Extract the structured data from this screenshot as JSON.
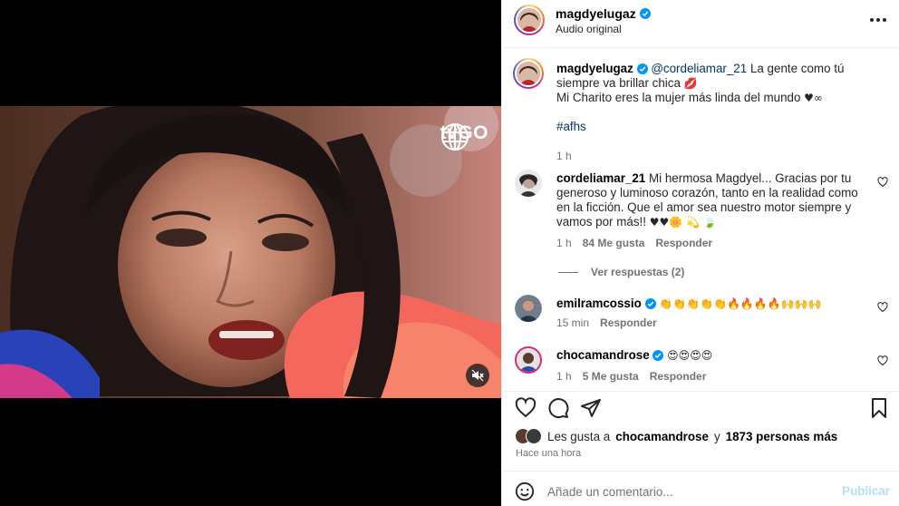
{
  "media": {
    "watermark_text": "tvGO",
    "watermark_icon": "globe-icon",
    "mute_icon": "speaker-muted-icon"
  },
  "header": {
    "username": "magdyelugaz",
    "subtitle": "Audio original",
    "more_icon": "more-options-icon"
  },
  "caption": {
    "username": "magdyelugaz",
    "mention": "@cordeliamar_21",
    "line1": "La gente como tú siempre va brillar chica",
    "line1_emoji": "💋",
    "line2": "Mi Charito eres la mujer más linda del mundo",
    "line2_emoji": "♥︎∞",
    "hashtag": "#afhs",
    "time": "1 h"
  },
  "comments": [
    {
      "username": "cordeliamar_21",
      "text": "Mi hermosa Magdyel... Gracias por tu generoso y luminoso corazón, tanto en la realidad como en la ficción. Que el amor sea nuestro motor siempre y vamos por más!!",
      "emoji": "♥♥🌼 💫 🍃",
      "time": "1 h",
      "likes": "84 Me gusta",
      "reply_label": "Responder",
      "view_replies": "Ver respuestas (2)"
    },
    {
      "username": "emilramcossio",
      "verified": true,
      "text": "",
      "emoji": "👏👏👏👏👏🔥🔥🔥🔥🙌🙌🙌",
      "time": "15 min",
      "likes": "",
      "reply_label": "Responder"
    },
    {
      "username": "chocamandrose",
      "verified": true,
      "text": "",
      "emoji": "😍😍😍😍",
      "time": "1 h",
      "likes": "5 Me gusta",
      "reply_label": "Responder"
    }
  ],
  "actions": {
    "like_icon": "heart-icon",
    "comment_icon": "comment-icon",
    "share_icon": "share-icon",
    "save_icon": "bookmark-icon"
  },
  "likes": {
    "prefix": "Les gusta a",
    "first_user": "chocamandrose",
    "connector": "y",
    "others": "1873 personas más"
  },
  "posted": "Hace una hora",
  "composer": {
    "placeholder": "Añade un comentario...",
    "post_label": "Publicar",
    "emoji_icon": "smiley-icon"
  },
  "colors": {
    "verified": "#0095f6",
    "link": "#00376b",
    "post_disabled": "#b2dffc"
  }
}
